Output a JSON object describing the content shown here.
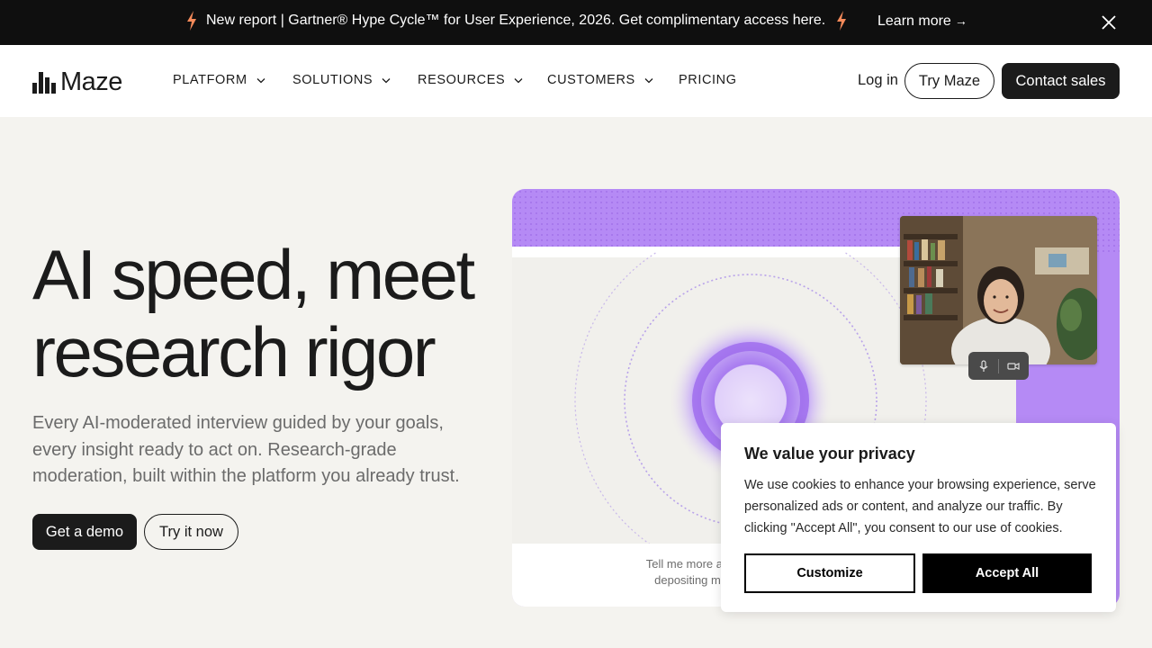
{
  "announcement": {
    "text": "New report | Gartner® Hype Cycle™ for User Experience, 2026. Get complimentary access here.",
    "link_label": "Learn more",
    "link_arrow": "→",
    "icons": [
      "bolt-icon",
      "close-icon"
    ],
    "bolt_color": "#f58a5a"
  },
  "nav": {
    "logo_text": "Maze",
    "items": [
      {
        "label": "PLATFORM",
        "has_dropdown": true
      },
      {
        "label": "SOLUTIONS",
        "has_dropdown": true
      },
      {
        "label": "RESOURCES",
        "has_dropdown": true
      },
      {
        "label": "CUSTOMERS",
        "has_dropdown": true
      },
      {
        "label": "PRICING",
        "has_dropdown": false
      }
    ],
    "login_label": "Log in",
    "try_label": "Try Maze",
    "contact_label": "Contact sales"
  },
  "hero": {
    "title_line1": "AI speed, meet",
    "title_line2": "research rigor",
    "subtitle": "Every AI-moderated interview guided by your goals, every insight ready to act on. Research-grade moderation, built within the platform you already trust.",
    "demo_label": "Get a demo",
    "trynow_label": "Try it now"
  },
  "visual": {
    "caption_line1": "Tell me more ab",
    "caption_line2": "depositing m",
    "accent_color": "#b58af5",
    "icons": [
      "microphone-icon",
      "camera-icon"
    ]
  },
  "cookie": {
    "title": "We value your privacy",
    "text": "We use cookies to enhance your browsing experience, serve personalized ads or content, and analyze our traffic. By clicking \"Accept All\", you consent to our use of cookies.",
    "customize_label": "Customize",
    "accept_label": "Accept All"
  }
}
